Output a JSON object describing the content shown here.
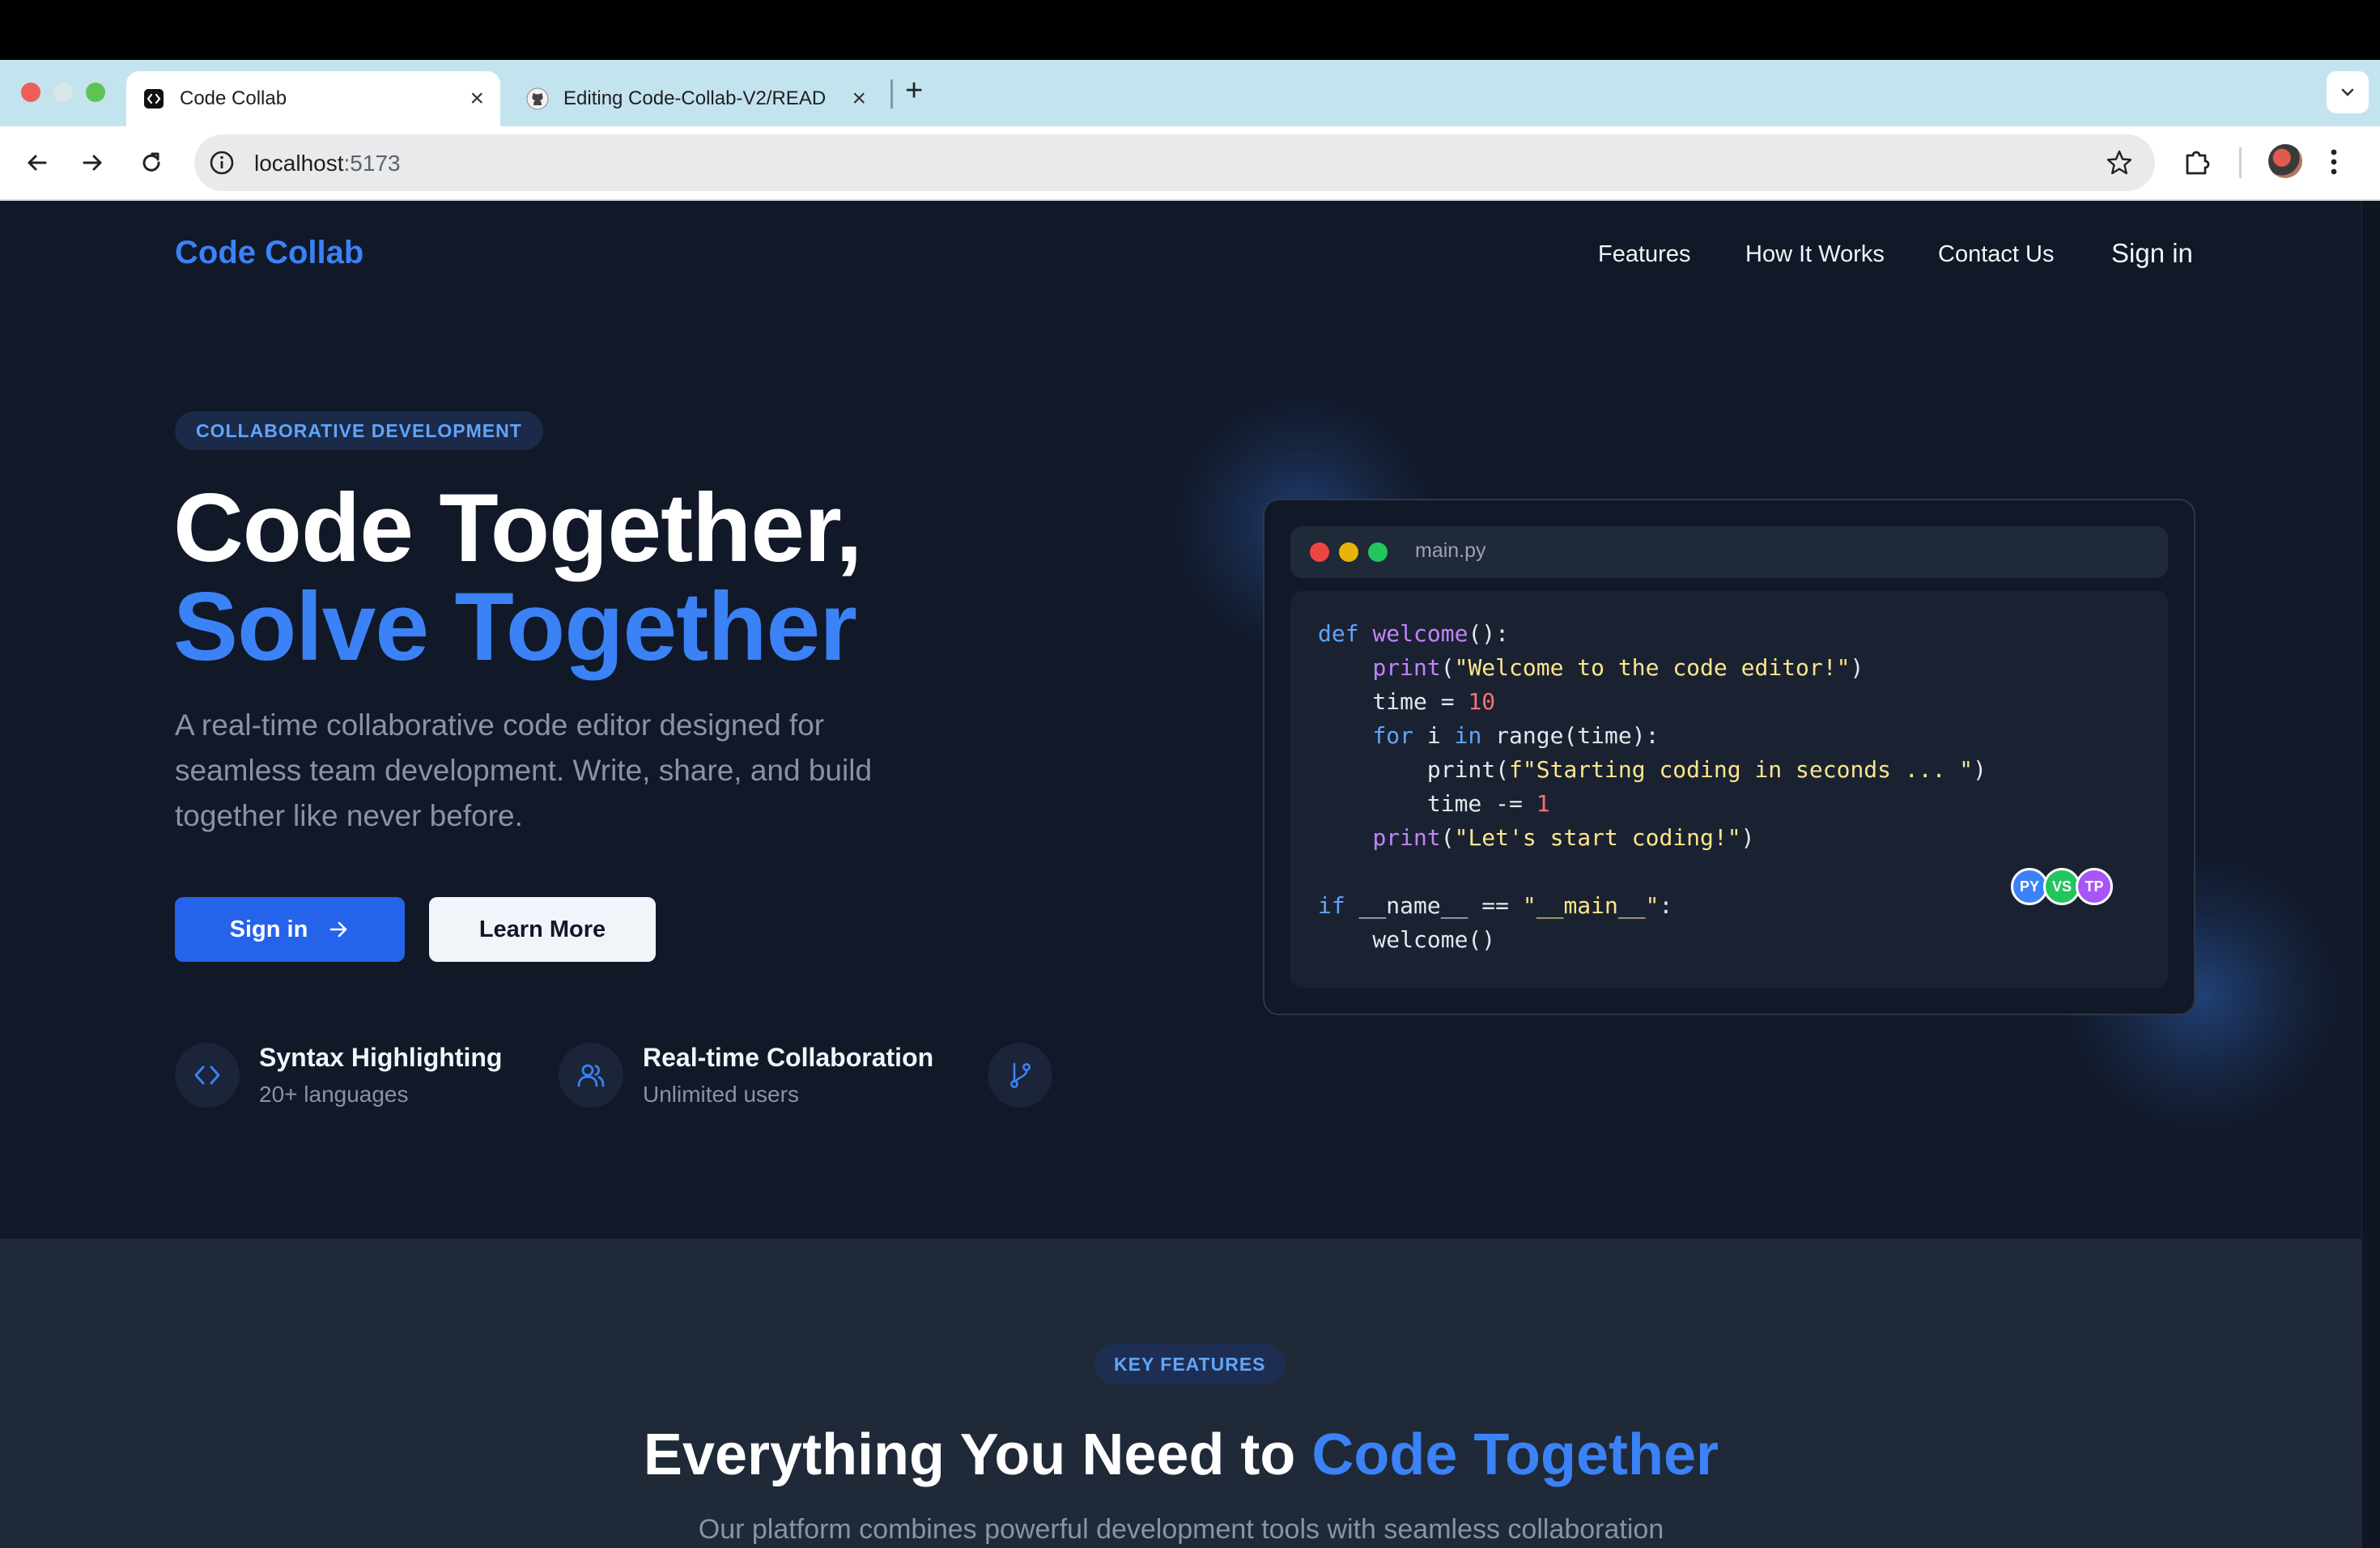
{
  "browser": {
    "tabs": [
      {
        "title": "Code Collab",
        "active": true
      },
      {
        "title": "Editing Code-Collab-V2/READ",
        "active": false
      }
    ],
    "address": {
      "host": "localhost",
      "port": ":5173"
    }
  },
  "header": {
    "brand": "Code Collab",
    "nav": [
      "Features",
      "How It Works",
      "Contact Us",
      "Sign in"
    ]
  },
  "hero": {
    "badge": "COLLABORATIVE DEVELOPMENT",
    "title_line1": "Code Together,",
    "title_line2": "Solve Together",
    "description": "A real-time collaborative code editor designed for seamless team development. Write, share, and build together like never before.",
    "primary_button": "Sign in",
    "secondary_button": "Learn More",
    "features": [
      {
        "title": "Syntax Highlighting",
        "subtitle": "20+ languages",
        "icon": "code-icon"
      },
      {
        "title": "Real-time Collaboration",
        "subtitle": "Unlimited users",
        "icon": "users-icon"
      },
      {
        "icon": "git-branch-icon"
      }
    ]
  },
  "editor": {
    "filename": "main.py",
    "collaborators": [
      {
        "initials": "PY",
        "color": "#3b82f6"
      },
      {
        "initials": "VS",
        "color": "#22c55e"
      },
      {
        "initials": "TP",
        "color": "#a855f7"
      }
    ]
  },
  "features_section": {
    "badge": "KEY FEATURES",
    "heading_prefix": "Everything You Need to ",
    "heading_accent": "Code Together",
    "subheading": "Our platform combines powerful development tools with seamless collaboration"
  },
  "colors": {
    "accent": "#3b82f6",
    "background": "#111827",
    "section_background": "#1f2937"
  }
}
